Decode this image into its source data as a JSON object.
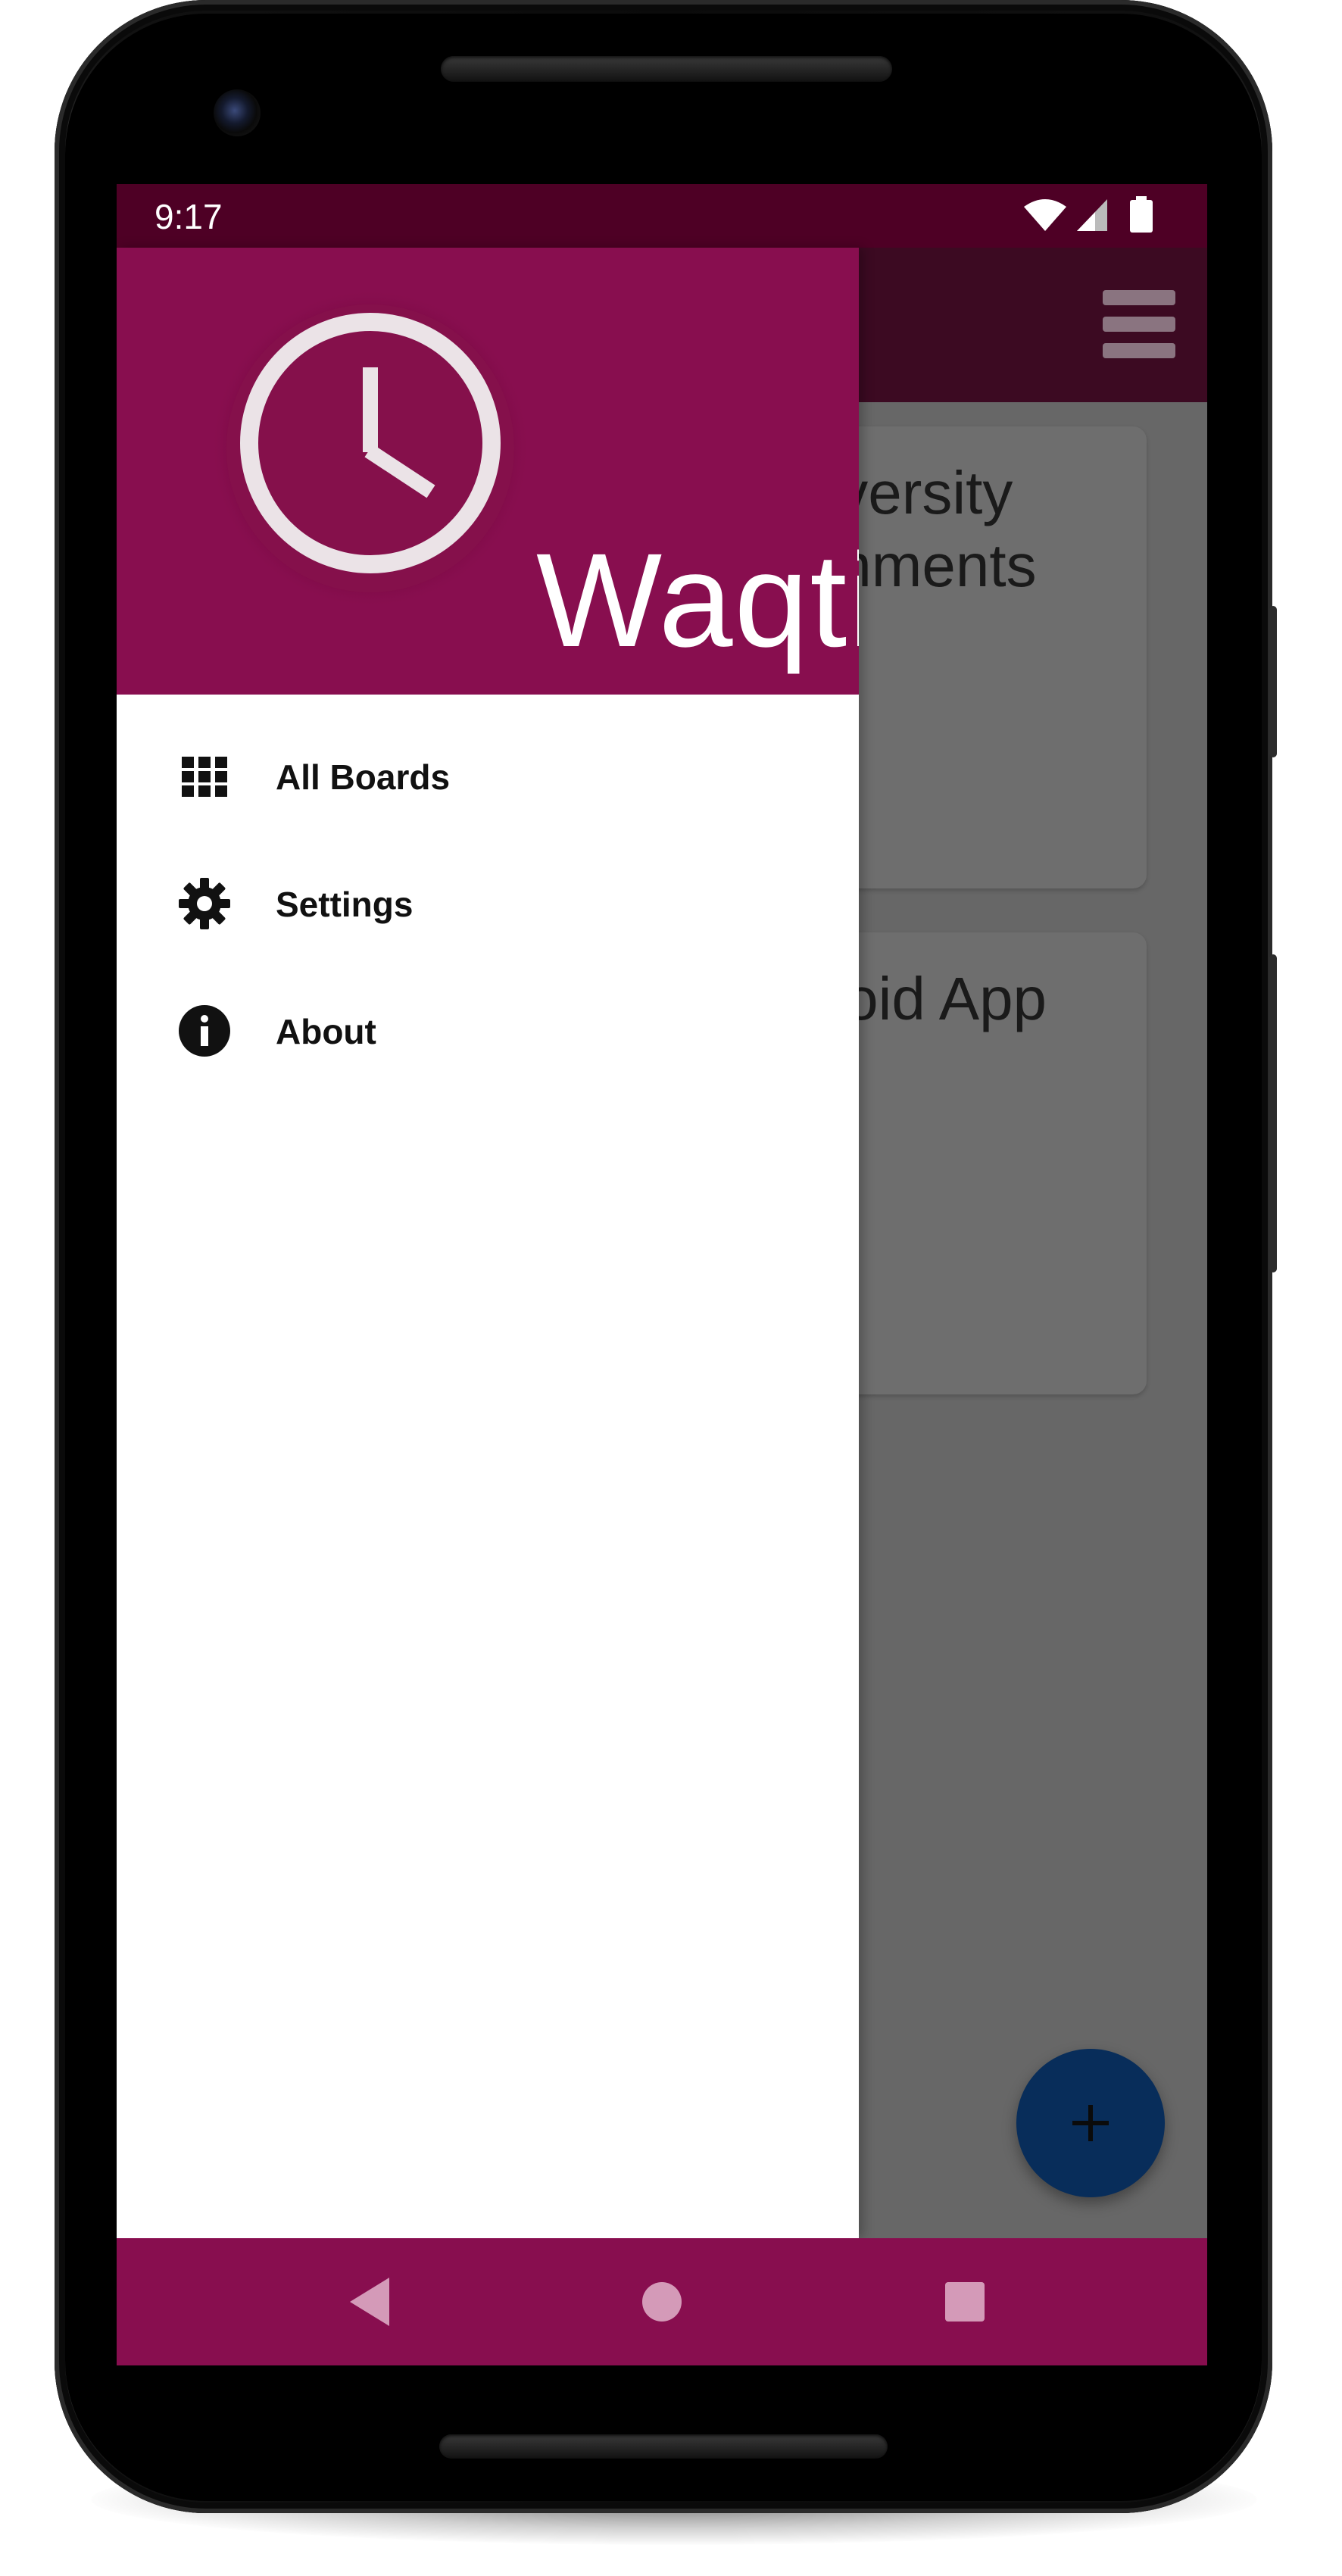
{
  "status_bar": {
    "time": "9:17"
  },
  "drawer": {
    "app_name": "Waqti",
    "items": [
      {
        "label": "All Boards",
        "icon": "grid-icon"
      },
      {
        "label": "Settings",
        "icon": "gear-icon"
      },
      {
        "label": "About",
        "icon": "info-icon"
      }
    ]
  },
  "boards": [
    {
      "title_line1": "niversity",
      "title_line2": "ignments"
    },
    {
      "title_line1": "droid App",
      "title_line2": ""
    }
  ],
  "colors": {
    "primary": "#880e4f",
    "primary_dark": "#4e0025",
    "fab": "#082d5a",
    "scrim": "#676767"
  }
}
